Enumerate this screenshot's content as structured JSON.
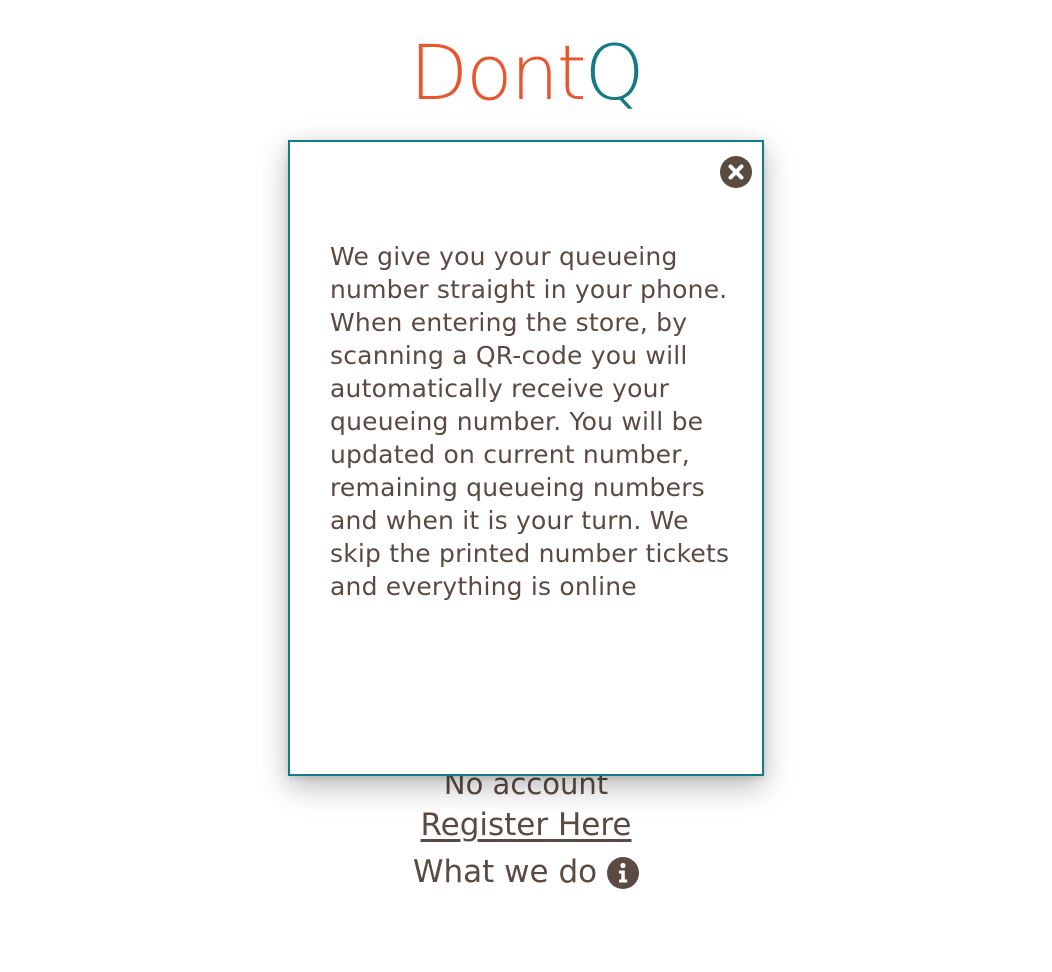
{
  "logo": {
    "part1": "Dont",
    "part2": "Q"
  },
  "links": {
    "no_account": "No account",
    "register": "Register Here",
    "what_we_do": "What we do"
  },
  "icons": {
    "info": "info-circle-icon",
    "close": "close-circle-icon"
  },
  "colors": {
    "brand_orange": "#e8552f",
    "brand_teal": "#147a86",
    "text": "#5b4a42"
  },
  "modal": {
    "text": "We give you your queueing number straight in your phone. When entering the store, by scanning a QR-code you will automatically receive your queueing number. You will be updated on current number, remaining queueing numbers and when it is your turn. We skip the printed number tickets and everything is online"
  }
}
